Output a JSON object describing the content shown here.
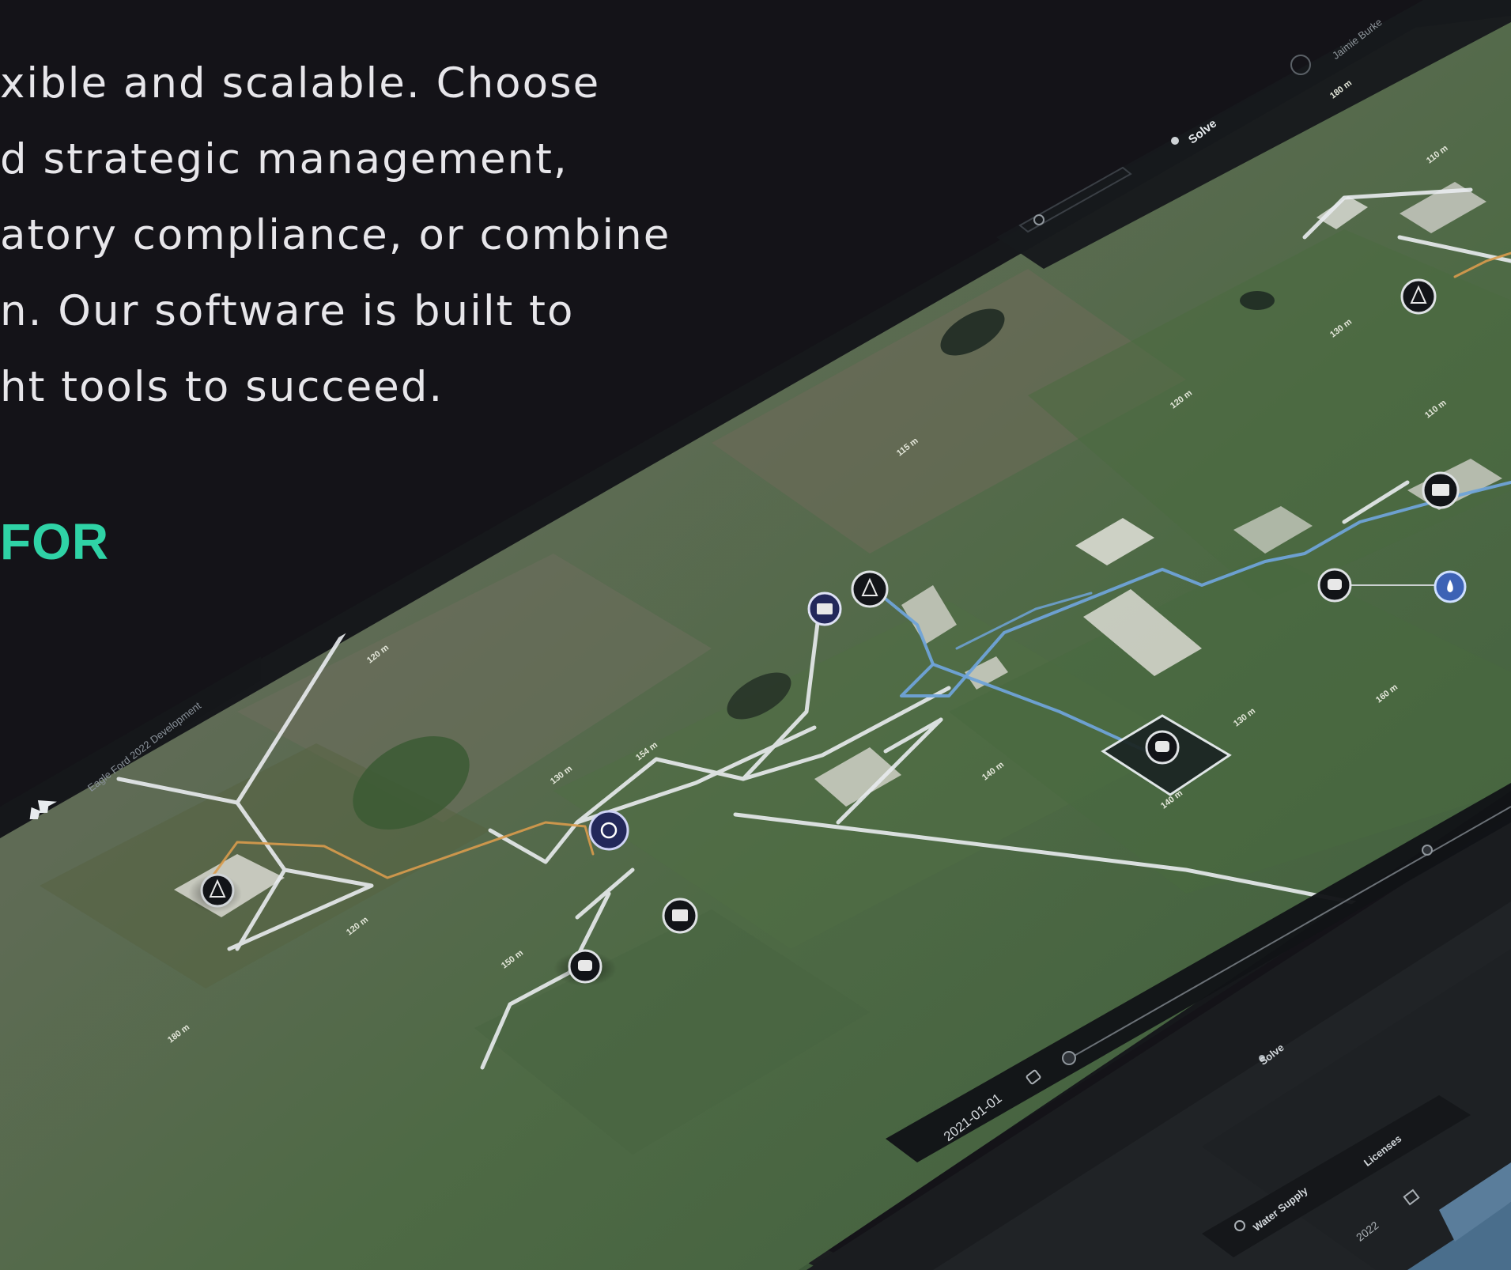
{
  "marketing": {
    "lines": [
      "xible and scalable. Choose",
      "d strategic management,",
      "atory compliance, or combine",
      "n. Our software is built to",
      "ht tools to succeed."
    ],
    "accent": "FOR"
  },
  "app": {
    "project_name": "Eagle Ford 2022 Development",
    "top_filter": "Solve",
    "user_name": "Jaimie Burke",
    "search_icon": "search-icon",
    "timeline": {
      "date": "2021-01-01"
    }
  },
  "map": {
    "distance_labels": [
      "120 m",
      "130 m",
      "154 m",
      "115 m",
      "120 m",
      "130 m",
      "180 m",
      "110 m",
      "140 m",
      "130 m",
      "160 m",
      "110 m",
      "140 m",
      "120 m",
      "150 m",
      "180 m"
    ],
    "markers": [
      {
        "type": "rig",
        "icon": "rig-icon"
      },
      {
        "type": "facility",
        "icon": "facility-icon"
      },
      {
        "type": "well",
        "icon": "well-icon"
      },
      {
        "type": "tank",
        "icon": "tank-icon"
      },
      {
        "type": "water",
        "icon": "water-drop-icon"
      }
    ]
  },
  "second_device": {
    "filter": "Solve",
    "tabs": [
      "Water Supply",
      "Licenses"
    ],
    "year": "2022"
  },
  "colors": {
    "background": "#141318",
    "accent": "#2fd3a6",
    "pipeline_blue": "#6fa3d8",
    "pipeline_orange": "#d99b4c",
    "road": "#e9ecef",
    "marker_navy": "#23285a"
  }
}
